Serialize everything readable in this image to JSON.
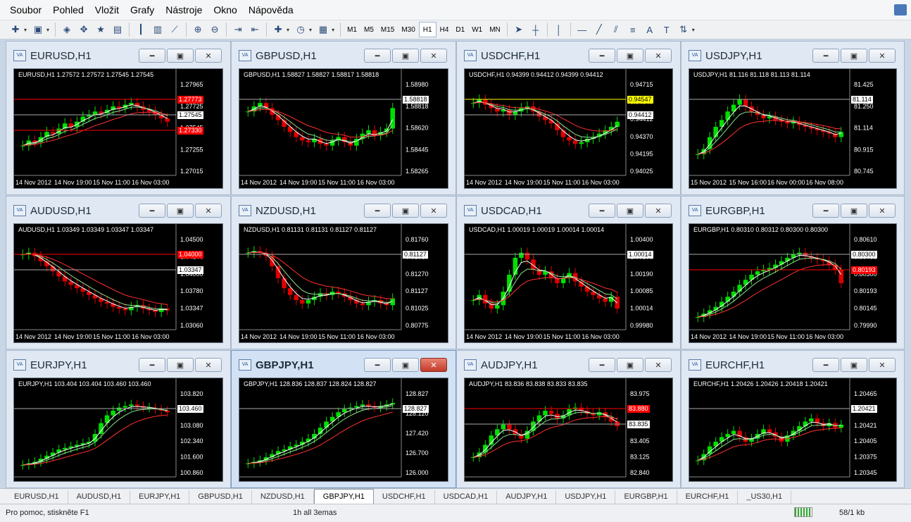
{
  "menu": [
    "Soubor",
    "Pohled",
    "Vložit",
    "Grafy",
    "Nástroje",
    "Okno",
    "Nápověda"
  ],
  "toolbar": {
    "timeframes": [
      "M1",
      "M5",
      "M15",
      "M30",
      "H1",
      "H4",
      "D1",
      "W1",
      "MN"
    ],
    "active_timeframe": "H1",
    "font_tool": "A"
  },
  "windows": [
    {
      "title": "EURUSD,H1",
      "header": "EURUSD,H1  1.27572 1.27572 1.27545 1.27545",
      "yticks": [
        "1.27965",
        "1.27725",
        "1.27545",
        "1.27255",
        "1.27015"
      ],
      "xticks": [
        "14 Nov 2012",
        "14 Nov 19:00",
        "15 Nov 11:00",
        "16 Nov 03:00"
      ],
      "tags": [
        {
          "text": "1.27773",
          "bg": "#ff0000",
          "fg": "#ffffff"
        },
        {
          "text": "1.27545",
          "bg": "#ffffff",
          "fg": "#000000"
        },
        {
          "text": "1.27330",
          "bg": "#ff0000",
          "fg": "#ffffff"
        }
      ],
      "candles": [
        30,
        36,
        34,
        40,
        46,
        44,
        50,
        56,
        52,
        58,
        64,
        66,
        70,
        68,
        72,
        76,
        74,
        78,
        80,
        76,
        72,
        70,
        66,
        62,
        58
      ]
    },
    {
      "title": "GBPUSD,H1",
      "header": "GBPUSD,H1  1.58827 1.58827 1.58817 1.58818",
      "yticks": [
        "1.58980",
        "1.58818",
        "1.58620",
        "1.58445",
        "1.58265"
      ],
      "xticks": [
        "14 Nov 2012",
        "14 Nov 19:00",
        "15 Nov 11:00",
        "16 Nov 03:00"
      ],
      "tags": [
        {
          "text": "1.58818",
          "bg": "#ffffff",
          "fg": "#000000"
        }
      ],
      "candles": [
        70,
        76,
        80,
        74,
        66,
        60,
        52,
        46,
        40,
        36,
        34,
        38,
        32,
        30,
        36,
        40,
        34,
        30,
        38,
        44,
        48,
        42,
        46,
        50,
        74
      ]
    },
    {
      "title": "USDCHF,H1",
      "header": "USDCHF,H1  0.94399 0.94412 0.94399 0.94412",
      "yticks": [
        "0.94715",
        "0.94547",
        "0.94412",
        "0.94370",
        "0.94195",
        "0.94025"
      ],
      "xticks": [
        "14 Nov 2012",
        "14 Nov 19:00",
        "15 Nov 11:00",
        "16 Nov 03:00"
      ],
      "tags": [
        {
          "text": "0.94547",
          "bg": "#ffff00",
          "fg": "#000000"
        },
        {
          "text": "0.94412",
          "bg": "#ffffff",
          "fg": "#000000"
        }
      ],
      "candles": [
        80,
        84,
        78,
        74,
        70,
        72,
        66,
        70,
        74,
        76,
        70,
        64,
        60,
        56,
        48,
        40,
        36,
        32,
        34,
        38,
        40,
        44,
        48,
        52,
        58
      ]
    },
    {
      "title": "USDJPY,H1",
      "header": "USDJPY,H1  81.116 81.118 81.113 81.114",
      "yticks": [
        "81.425",
        "81.250",
        "81.114",
        "80.915",
        "80.745"
      ],
      "xticks": [
        "15 Nov 2012",
        "15 Nov 16:00",
        "16 Nov 00:00",
        "16 Nov 08:00"
      ],
      "tags": [
        {
          "text": "81.114",
          "bg": "#ffffff",
          "fg": "#000000"
        }
      ],
      "candles": [
        20,
        26,
        40,
        52,
        60,
        70,
        78,
        84,
        76,
        70,
        66,
        62,
        64,
        60,
        58,
        56,
        58,
        54,
        52,
        50,
        48,
        46,
        44,
        40,
        46
      ]
    },
    {
      "title": "AUDUSD,H1",
      "header": "AUDUSD,H1  1.03349 1.03349 1.03347 1.03347",
      "yticks": [
        "1.04500",
        "1.04140",
        "1.04000",
        "1.03780",
        "1.03347",
        "1.03060"
      ],
      "xticks": [
        "14 Nov 2012",
        "14 Nov 19:00",
        "15 Nov 11:00",
        "16 Nov 03:00"
      ],
      "tags": [
        {
          "text": "1.04000",
          "bg": "#ff0000",
          "fg": "#ffffff"
        },
        {
          "text": "1.03347",
          "bg": "#ffffff",
          "fg": "#000000"
        }
      ],
      "candles": [
        84,
        86,
        82,
        76,
        70,
        64,
        58,
        52,
        48,
        44,
        40,
        36,
        32,
        28,
        26,
        22,
        20,
        18,
        22,
        24,
        20,
        18,
        16,
        20,
        18
      ]
    },
    {
      "title": "NZDUSD,H1",
      "header": "NZDUSD,H1  0.81131 0.81131 0.81127 0.81127",
      "yticks": [
        "0.81760",
        "0.81515",
        "0.81270",
        "0.81127",
        "0.81025",
        "0.80775"
      ],
      "xticks": [
        "14 Nov 2012",
        "14 Nov 19:00",
        "15 Nov 11:00",
        "16 Nov 03:00"
      ],
      "tags": [
        {
          "text": "0.81127",
          "bg": "#ffffff",
          "fg": "#000000"
        }
      ],
      "candles": [
        86,
        88,
        86,
        82,
        70,
        56,
        44,
        36,
        30,
        26,
        30,
        34,
        38,
        36,
        40,
        38,
        34,
        30,
        26,
        24,
        28,
        30,
        26,
        24,
        32
      ]
    },
    {
      "title": "USDCAD,H1",
      "header": "USDCAD,H1  1.00019 1.00019 1.00014 1.00014",
      "yticks": [
        "1.00400",
        "1.00295",
        "1.00190",
        "1.00085",
        "1.00014",
        "0.99980"
      ],
      "xticks": [
        "14 Nov 2012",
        "14 Nov 19:00",
        "15 Nov 11:00",
        "16 Nov 03:00"
      ],
      "tags": [
        {
          "text": "1.00014",
          "bg": "#ffffff",
          "fg": "#000000"
        }
      ],
      "candles": [
        30,
        36,
        26,
        20,
        24,
        40,
        60,
        80,
        86,
        78,
        66,
        60,
        64,
        56,
        50,
        56,
        62,
        52,
        46,
        40,
        36,
        32,
        28,
        34,
        20
      ]
    },
    {
      "title": "EURGBP,H1",
      "header": "EURGBP,H1  0.80310 0.80312 0.80300 0.80300",
      "yticks": [
        "0.80610",
        "0.80455",
        "0.80300",
        "0.80193",
        "0.80145",
        "0.79990"
      ],
      "xticks": [
        "14 Nov 2012",
        "14 Nov 19:00",
        "15 Nov 11:00",
        "16 Nov 03:00"
      ],
      "tags": [
        {
          "text": "0.80300",
          "bg": "#ffffff",
          "fg": "#000000"
        },
        {
          "text": "0.80193",
          "bg": "#ff0000",
          "fg": "#ffffff"
        }
      ],
      "candles": [
        10,
        14,
        18,
        22,
        28,
        34,
        40,
        48,
        54,
        60,
        64,
        66,
        68,
        72,
        76,
        80,
        84,
        86,
        82,
        80,
        78,
        76,
        72,
        66,
        50
      ]
    },
    {
      "title": "EURJPY,H1",
      "header": "EURJPY,H1  103.404 103.404 103.460 103.460",
      "yticks": [
        "103.820",
        "103.460",
        "103.080",
        "102.340",
        "101.600",
        "100.860"
      ],
      "xticks": [],
      "tags": [
        {
          "text": "103.460",
          "bg": "#ffffff",
          "fg": "#000000"
        }
      ],
      "candles": [
        10,
        12,
        14,
        18,
        22,
        26,
        30,
        32,
        34,
        36,
        38,
        40,
        50,
        64,
        74,
        80,
        84,
        86,
        88,
        86,
        84,
        84,
        82,
        80,
        78
      ]
    },
    {
      "title": "GBPJPY,H1",
      "header": "GBPJPY,H1  128.836 128.837 128.824 128.827",
      "yticks": [
        "128.827",
        "128.120",
        "127.420",
        "126.700",
        "126.000"
      ],
      "xticks": [],
      "tags": [
        {
          "text": "128.827",
          "bg": "#ffffff",
          "fg": "#000000"
        }
      ],
      "candles": [
        12,
        14,
        16,
        20,
        24,
        28,
        30,
        34,
        36,
        40,
        44,
        50,
        58,
        66,
        72,
        78,
        82,
        84,
        86,
        88,
        86,
        84,
        86,
        88,
        90
      ]
    },
    {
      "title": "AUDJPY,H1",
      "header": "AUDJPY,H1  83.836 83.838 83.833 83.835",
      "yticks": [
        "83.975",
        "83.835",
        "83.690",
        "83.405",
        "83.125",
        "82.840"
      ],
      "xticks": [],
      "tags": [
        {
          "text": "83.880",
          "bg": "#ff0000",
          "fg": "#ffffff"
        },
        {
          "text": "83.835",
          "bg": "#ffffff",
          "fg": "#000000"
        }
      ],
      "candles": [
        20,
        26,
        36,
        48,
        56,
        62,
        56,
        50,
        44,
        54,
        66,
        74,
        80,
        76,
        70,
        74,
        82,
        84,
        80,
        76,
        74,
        78,
        72,
        66,
        60
      ]
    },
    {
      "title": "EURCHF,H1",
      "header": "EURCHF,H1  1.20426 1.20426 1.20418 1.20421",
      "yticks": [
        "1.20465",
        "1.20435",
        "1.20421",
        "1.20405",
        "1.20375",
        "1.20345"
      ],
      "xticks": [],
      "tags": [
        {
          "text": "1.20421",
          "bg": "#ffffff",
          "fg": "#000000"
        }
      ],
      "candles": [
        16,
        24,
        34,
        40,
        46,
        50,
        54,
        46,
        40,
        44,
        50,
        56,
        52,
        46,
        40,
        48,
        54,
        60,
        66,
        70,
        64,
        60,
        64,
        58,
        62
      ]
    }
  ],
  "active_window": 9,
  "tabs": [
    "EURUSD,H1",
    "AUDUSD,H1",
    "EURJPY,H1",
    "GBPUSD,H1",
    "NZDUSD,H1",
    "GBPJPY,H1",
    "USDCHF,H1",
    "USDCAD,H1",
    "AUDJPY,H1",
    "USDJPY,H1",
    "EURGBP,H1",
    "EURCHF,H1",
    "_US30,H1"
  ],
  "active_tab": 5,
  "status": {
    "help": "Pro pomoc, stiskněte F1",
    "profile": "1h all 3emas",
    "traffic": "58/1 kb"
  },
  "colors": {
    "bull": "#00e000",
    "bear": "#e00000",
    "plot_bg": "#000000",
    "ma_fast": "#ffffff",
    "ma_mid": "#8fe08f",
    "ma_slow": "#ff3030"
  }
}
